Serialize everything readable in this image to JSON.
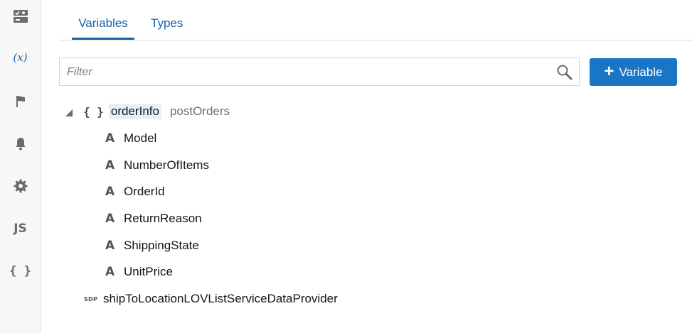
{
  "rail": {
    "items": [
      {
        "icon": "overview-icon"
      },
      {
        "icon": "variables-icon",
        "label": "(x)"
      },
      {
        "icon": "flag-icon"
      },
      {
        "icon": "bell-icon"
      },
      {
        "icon": "gear-icon"
      },
      {
        "icon": "javascript-icon",
        "label": "JS"
      },
      {
        "icon": "json-icon",
        "label": "{ }"
      }
    ]
  },
  "tabs": [
    {
      "label": "Variables",
      "active": true
    },
    {
      "label": "Types",
      "active": false
    }
  ],
  "filter": {
    "placeholder": "Filter",
    "value": ""
  },
  "add_button": {
    "label": "Variable"
  },
  "tree": {
    "root": {
      "icon_text": "{ }",
      "name": "orderInfo",
      "type": "postOrders",
      "expanded": true,
      "children": [
        {
          "icon_text": "A",
          "name": "Model"
        },
        {
          "icon_text": "A",
          "name": "NumberOfItems"
        },
        {
          "icon_text": "A",
          "name": "OrderId"
        },
        {
          "icon_text": "A",
          "name": "ReturnReason"
        },
        {
          "icon_text": "A",
          "name": "ShippingState"
        },
        {
          "icon_text": "A",
          "name": "UnitPrice"
        }
      ]
    },
    "sdp": {
      "icon_text": "SDP",
      "name": "shipToLocationLOVListServiceDataProvider"
    }
  },
  "colors": {
    "accent": "#1976c5",
    "tab_text": "#1a5fa8",
    "selection": "#e4f0fb"
  }
}
